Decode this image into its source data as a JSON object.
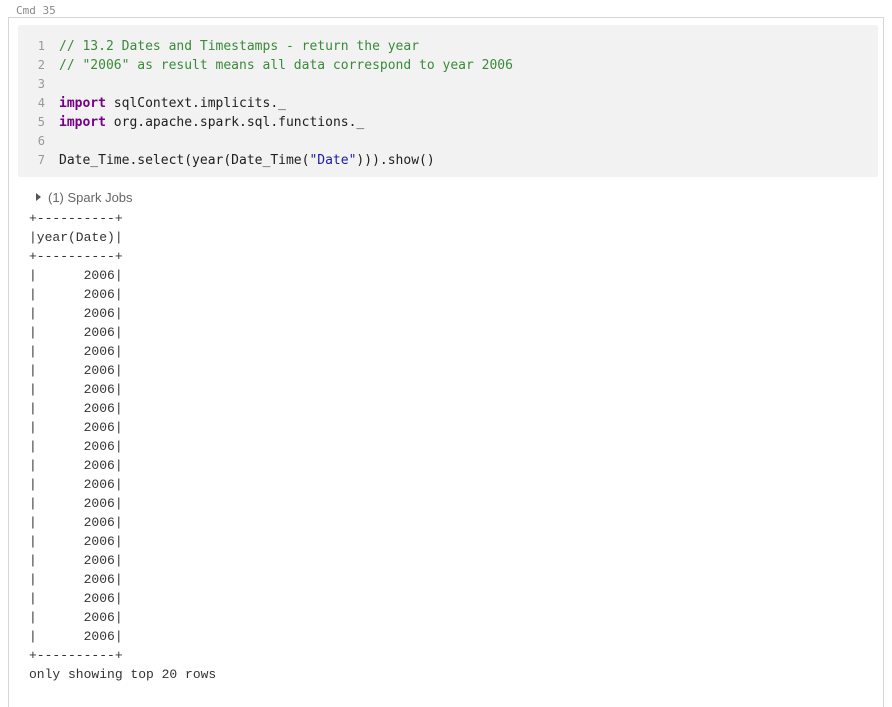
{
  "cell": {
    "label": "Cmd 35"
  },
  "code": {
    "lines": [
      {
        "n": "1",
        "parts": [
          {
            "t": "cmt",
            "v": "// 13.2 Dates and Timestamps - return the year"
          }
        ]
      },
      {
        "n": "2",
        "parts": [
          {
            "t": "cmt",
            "v": "// \"2006\" as result means all data correspond to year 2006"
          }
        ]
      },
      {
        "n": "3",
        "parts": []
      },
      {
        "n": "4",
        "parts": [
          {
            "t": "kw",
            "v": "import"
          },
          {
            "t": "plain",
            "v": " sqlContext.implicits._"
          }
        ]
      },
      {
        "n": "5",
        "parts": [
          {
            "t": "kw",
            "v": "import"
          },
          {
            "t": "plain",
            "v": " org.apache.spark.sql.functions._"
          }
        ]
      },
      {
        "n": "6",
        "parts": []
      },
      {
        "n": "7",
        "parts": [
          {
            "t": "plain",
            "v": "Date_Time.select(year(Date_Time("
          },
          {
            "t": "str",
            "v": "\"Date\""
          },
          {
            "t": "plain",
            "v": "))).show()"
          }
        ]
      }
    ]
  },
  "spark_jobs": {
    "label": "(1) Spark Jobs"
  },
  "output": {
    "border": "+----------+",
    "header": "|year(Date)|",
    "rows": [
      "2006",
      "2006",
      "2006",
      "2006",
      "2006",
      "2006",
      "2006",
      "2006",
      "2006",
      "2006",
      "2006",
      "2006",
      "2006",
      "2006",
      "2006",
      "2006",
      "2006",
      "2006",
      "2006",
      "2006"
    ],
    "footer": "only showing top 20 rows"
  },
  "colors": {
    "comment": "#3a8a3a",
    "keyword": "#770088",
    "string": "#1a1aa6",
    "code_bg": "#f2f2f2"
  }
}
